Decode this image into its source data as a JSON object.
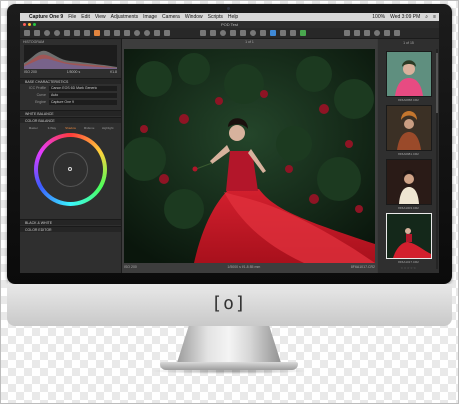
{
  "menubar": {
    "apple": "",
    "app_name": "Capture One 9",
    "items": [
      "File",
      "Edit",
      "View",
      "Adjustments",
      "Image",
      "Camera",
      "Window",
      "Scripts",
      "Help"
    ],
    "battery": "100%",
    "time": "Wed 3:09 PM"
  },
  "window": {
    "title": "POD Test",
    "traffic_lights": [
      "#ff5f57",
      "#febc2e",
      "#28c840"
    ]
  },
  "left_panel": {
    "histogram_label": "HISTOGRAM",
    "histogram_info": {
      "iso": "ISO 200",
      "shutter": "1/5000 s",
      "fstop": "f/1.8"
    },
    "sections": {
      "base": "BASE CHARACTERISTICS",
      "white_balance": "WHITE BALANCE",
      "color_balance": "COLOR BALANCE",
      "black_white": "BLACK & WHITE",
      "color_editor": "COLOR EDITOR"
    },
    "base_rows": [
      {
        "key": "ICC Profile",
        "value": "Canon EOS 6D Mark Generic"
      },
      {
        "key": "Curve",
        "value": "Auto"
      },
      {
        "key": "Engine",
        "value": "Capture One 9"
      }
    ],
    "color_tabs": [
      "Master",
      "3-Way",
      "Shadow",
      "Midtone",
      "Highlight"
    ],
    "color_tab_active": "Shadow"
  },
  "viewer": {
    "top_label": "1 of 1",
    "status_left": "ISO 200",
    "status_mid": "1/5000 s  f/1.8  85 mm",
    "filename": "8F6A1017.CR2"
  },
  "browser": {
    "header": "1 of 15",
    "thumbs": [
      {
        "label": "8F6A0958.CR2"
      },
      {
        "label": "8F6A0981.CR2"
      },
      {
        "label": "8F6A1003.CR2"
      },
      {
        "label": "8F6A1017.CR2"
      }
    ],
    "stars": "☆☆☆☆☆"
  },
  "monitor": {
    "chin_logo": "[o]"
  }
}
